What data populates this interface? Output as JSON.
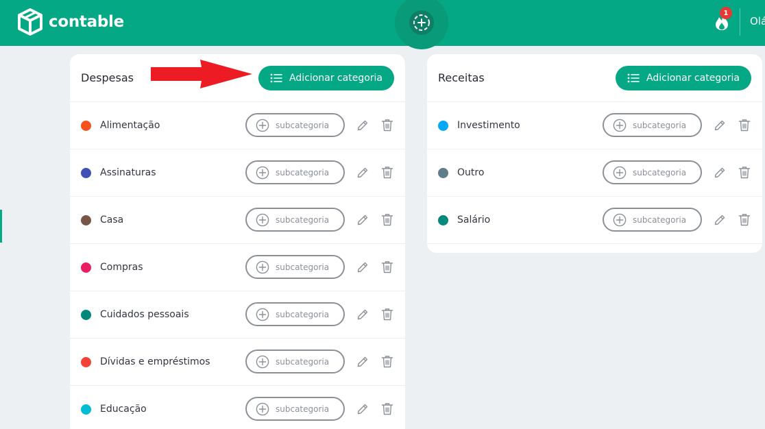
{
  "header": {
    "brand": "contable",
    "streak_count": "1",
    "greeting": "Olá"
  },
  "expenses": {
    "title": "Despesas",
    "add_label": "Adicionar categoria",
    "items": [
      {
        "name": "Alimentação",
        "color": "#f4511e"
      },
      {
        "name": "Assinaturas",
        "color": "#3f51b5"
      },
      {
        "name": "Casa",
        "color": "#795548"
      },
      {
        "name": "Compras",
        "color": "#e91e63"
      },
      {
        "name": "Cuidados pessoais",
        "color": "#00897b"
      },
      {
        "name": "Dívidas e empréstimos",
        "color": "#f44336"
      },
      {
        "name": "Educação",
        "color": "#00bcd4"
      }
    ]
  },
  "income": {
    "title": "Receitas",
    "add_label": "Adicionar categoria",
    "items": [
      {
        "name": "Investimento",
        "color": "#03a9f4"
      },
      {
        "name": "Outro",
        "color": "#607d8b"
      },
      {
        "name": "Salário",
        "color": "#00897b"
      }
    ]
  },
  "row_actions": {
    "subcategory_label": "subcategoria"
  },
  "colors": {
    "brand": "#05a884",
    "annotation_arrow": "#ed1c24"
  },
  "icons": {
    "logo": "box-logo-icon",
    "new": "add-circle-icon",
    "streak": "flame-icon",
    "add_category": "list-icon",
    "subcategory": "plus-circle-icon",
    "edit": "pencil-icon",
    "delete": "trash-icon"
  }
}
